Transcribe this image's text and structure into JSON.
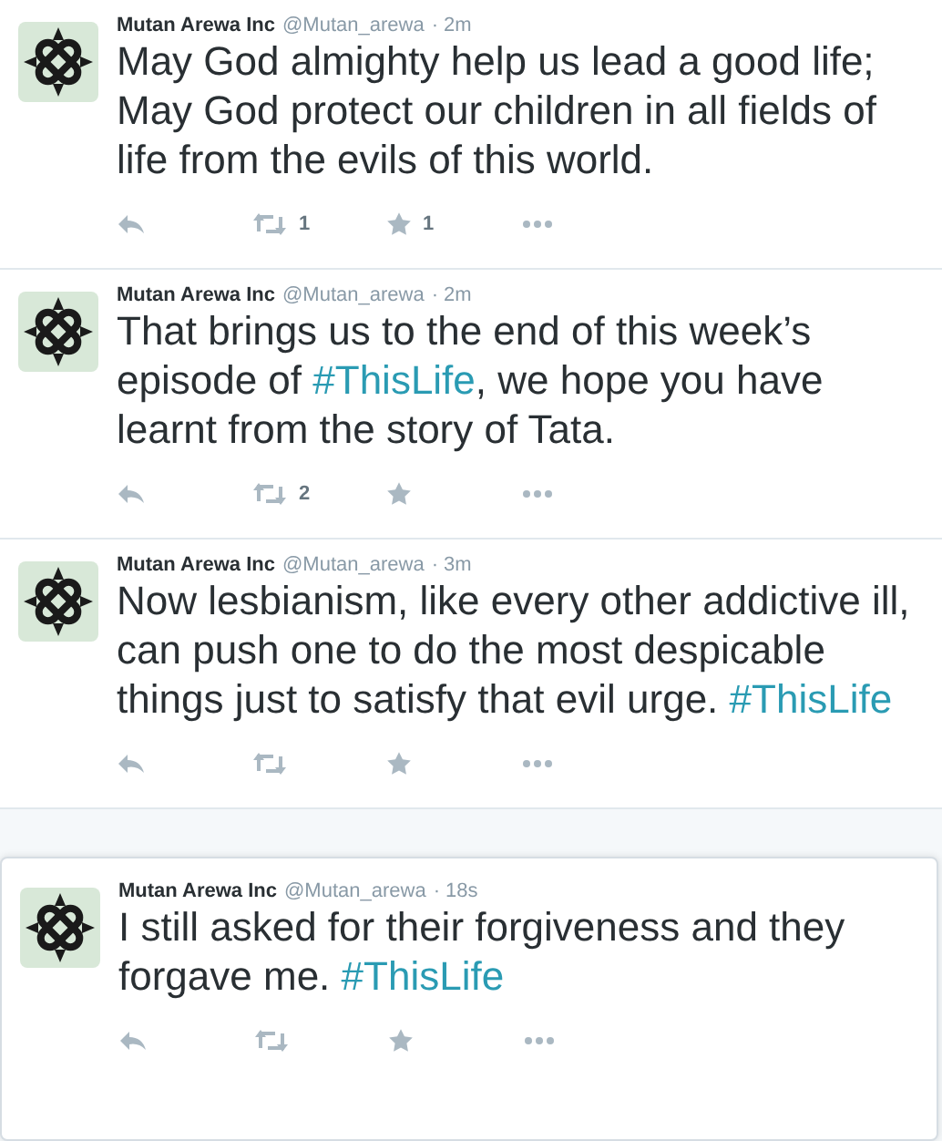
{
  "tweets": [
    {
      "name": "Mutan Arewa Inc",
      "handle": "@Mutan_arewa",
      "time": "· 2m",
      "focused": false,
      "parts": [
        {
          "kind": "plain",
          "text": "May God almighty help us lead a good life; May God protect our children in all fields of life from the evils of this world."
        }
      ],
      "retweets": "1",
      "favorites": "1"
    },
    {
      "name": "Mutan Arewa Inc",
      "handle": "@Mutan_arewa",
      "time": "· 2m",
      "focused": false,
      "parts": [
        {
          "kind": "plain",
          "text": "That brings us to the end of this week’s episode of "
        },
        {
          "kind": "hashtag",
          "text": "#ThisLife"
        },
        {
          "kind": "plain",
          "text": ", we hope you have learnt from the story of Tata."
        }
      ],
      "retweets": "2"
    },
    {
      "name": "Mutan Arewa Inc",
      "handle": "@Mutan_arewa",
      "time": "· 3m",
      "focused": false,
      "parts": [
        {
          "kind": "plain",
          "text": "Now lesbianism, like every other addictive ill, can push one to do the most despicable things just to satisfy that evil urge. "
        },
        {
          "kind": "hashtag",
          "text": "#ThisLife"
        }
      ]
    },
    {
      "name": "Mutan Arewa Inc",
      "handle": "@Mutan_arewa",
      "time": "· 18s",
      "focused": true,
      "parts": [
        {
          "kind": "plain",
          "text": "I still asked for their forgiveness and they forgave me. "
        },
        {
          "kind": "hashtag",
          "text": "#ThisLife"
        }
      ]
    }
  ]
}
